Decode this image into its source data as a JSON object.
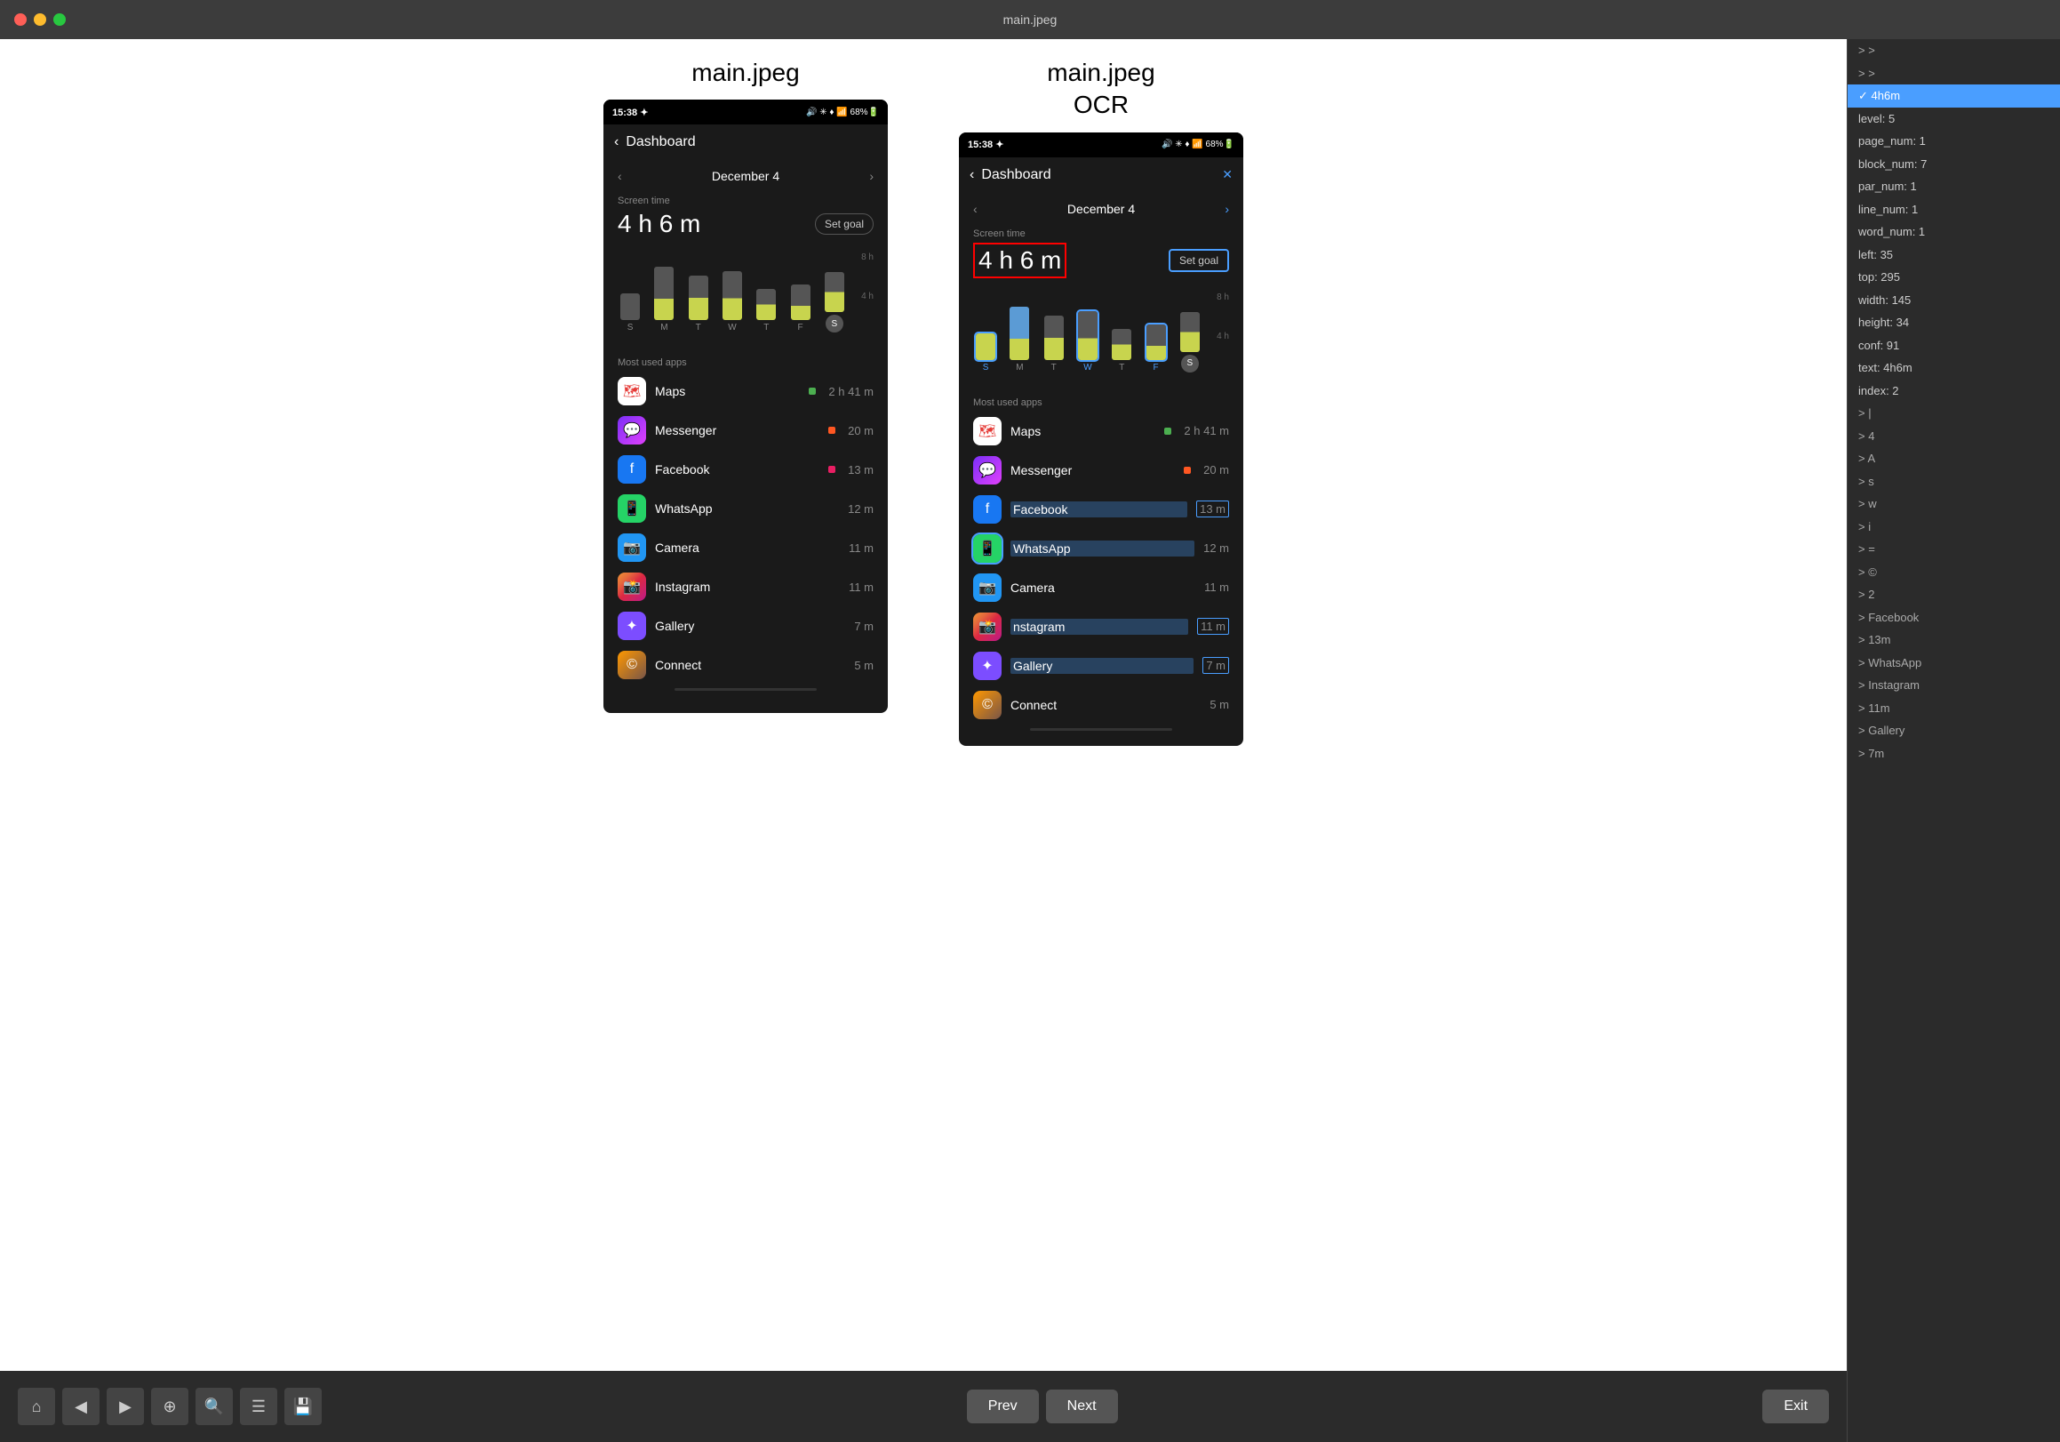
{
  "titleBar": {
    "title": "main.jpeg"
  },
  "leftSection": {
    "title": "main.jpeg",
    "subtitle": null
  },
  "rightSection": {
    "title": "main.jpeg",
    "subtitle": "OCR"
  },
  "phone": {
    "statusTime": "15:38",
    "statusIcons": "🔊 ✳ ♦ 🔔 📶 68% 🔋",
    "navTitle": "Dashboard",
    "dateText": "December 4",
    "screenTimeLabel": "Screen time",
    "mainTime": "4 h 6 m",
    "setGoalLabel": "Set goal",
    "chartLabels": {
      "h8": "8 h",
      "h4": "4 h"
    },
    "weekDays": [
      "S",
      "M",
      "T",
      "W",
      "T",
      "F",
      "S"
    ],
    "apps": [
      {
        "name": "Maps",
        "time": "2 h 41 m",
        "color": "maps"
      },
      {
        "name": "Messenger",
        "time": "20 m",
        "color": "messenger"
      },
      {
        "name": "Facebook",
        "time": "13 m",
        "color": "facebook"
      },
      {
        "name": "WhatsApp",
        "time": "12 m",
        "color": "whatsapp"
      },
      {
        "name": "Camera",
        "time": "11 m",
        "color": "camera"
      },
      {
        "name": "Instagram",
        "time": "11 m",
        "color": "instagram"
      },
      {
        "name": "Gallery",
        "time": "7 m",
        "color": "gallery"
      },
      {
        "name": "Connect",
        "time": "5 m",
        "color": "connect"
      }
    ],
    "mostUsedLabel": "Most used apps"
  },
  "ocrPanel": {
    "items": [
      {
        "text": "> >",
        "type": "arrow"
      },
      {
        "text": "> >",
        "type": "arrow"
      },
      {
        "text": "✓ 4h6m",
        "type": "selected"
      },
      {
        "text": "  level: 5",
        "type": "normal"
      },
      {
        "text": "  page_num: 1",
        "type": "normal"
      },
      {
        "text": "  block_num: 7",
        "type": "normal"
      },
      {
        "text": "  par_num: 1",
        "type": "normal"
      },
      {
        "text": "  line_num: 1",
        "type": "normal"
      },
      {
        "text": "  word_num: 1",
        "type": "normal"
      },
      {
        "text": "  left: 35",
        "type": "normal"
      },
      {
        "text": "  top: 295",
        "type": "normal"
      },
      {
        "text": "  width: 145",
        "type": "normal"
      },
      {
        "text": "  height: 34",
        "type": "normal"
      },
      {
        "text": "  conf: 91",
        "type": "normal"
      },
      {
        "text": "  text: 4h6m",
        "type": "normal"
      },
      {
        "text": "  index: 2",
        "type": "normal"
      },
      {
        "text": "> |",
        "type": "arrow"
      },
      {
        "text": "> 4",
        "type": "arrow"
      },
      {
        "text": "> A",
        "type": "arrow"
      },
      {
        "text": "> s",
        "type": "arrow"
      },
      {
        "text": "> w",
        "type": "arrow"
      },
      {
        "text": "> i",
        "type": "arrow"
      },
      {
        "text": "> =",
        "type": "arrow"
      },
      {
        "text": "> ©",
        "type": "arrow"
      },
      {
        "text": "> 2",
        "type": "arrow"
      },
      {
        "text": "> Facebook",
        "type": "arrow"
      },
      {
        "text": "> 13m",
        "type": "arrow"
      },
      {
        "text": "> WhatsApp",
        "type": "arrow"
      },
      {
        "text": "> Instagram",
        "type": "arrow"
      },
      {
        "text": "> 11m",
        "type": "arrow"
      },
      {
        "text": "> Gallery",
        "type": "arrow"
      },
      {
        "text": "> 7m",
        "type": "arrow"
      }
    ]
  },
  "toolbar": {
    "buttons": [
      "⌂",
      "◀",
      "▶",
      "⊕",
      "🔍",
      "☰",
      "💾"
    ],
    "prevLabel": "Prev",
    "nextLabel": "Next",
    "exitLabel": "Exit"
  }
}
